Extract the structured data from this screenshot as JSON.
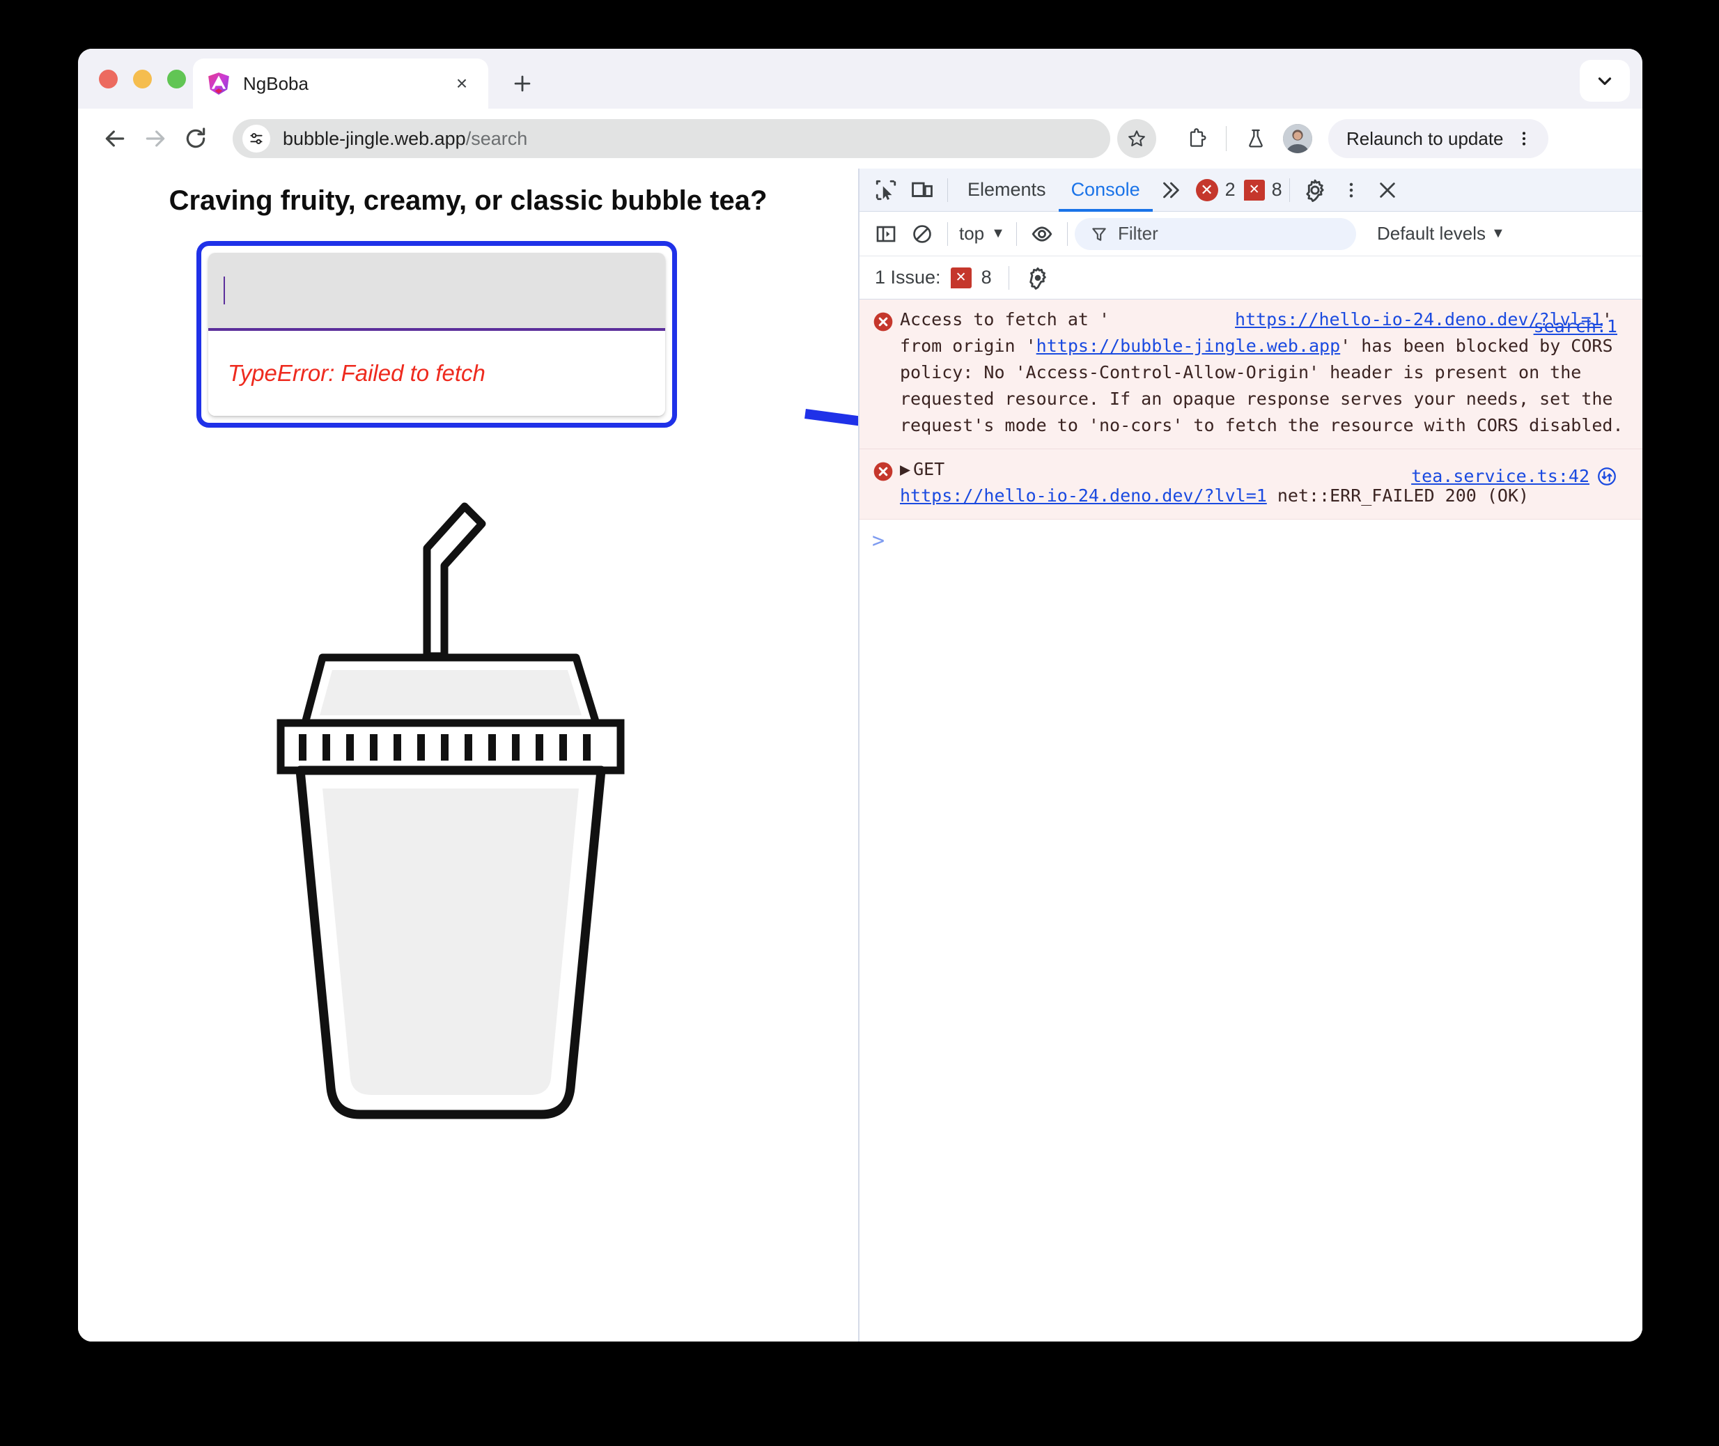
{
  "window": {
    "traffic_lights": [
      "close",
      "minimize",
      "maximize"
    ],
    "collapse_icon": "chevron-down-icon"
  },
  "tab": {
    "favicon": "angular-logo-icon",
    "title": "NgBoba",
    "close_label": "×",
    "new_tab_label": "+"
  },
  "toolbar": {
    "back_icon": "arrow-left-icon",
    "forward_icon": "arrow-right-icon",
    "reload_icon": "reload-icon",
    "site_info_icon": "tune-icon",
    "url_host": "bubble-jingle.web.app",
    "url_path": "/search",
    "bookmark_icon": "star-icon",
    "extensions_icon": "extension-icon",
    "labs_icon": "flask-icon",
    "avatar_icon": "profile-avatar",
    "relaunch_label": "Relaunch to update",
    "menu_icon": "kebab-menu-icon"
  },
  "page": {
    "heading": "Craving fruity, creamy, or classic bubble tea?",
    "search": {
      "value": "",
      "placeholder": "",
      "error": "TypeError: Failed to fetch"
    },
    "illustration": "bubble-tea-cup-icon",
    "annotation": {
      "highlight_color": "#1f31e8",
      "arrow": "blue-arrow-right"
    }
  },
  "devtools": {
    "inspect_icon": "inspect-element-icon",
    "device_icon": "device-toolbar-icon",
    "tabs": [
      {
        "label": "Elements",
        "active": false
      },
      {
        "label": "Console",
        "active": true
      }
    ],
    "more_tabs_icon": "chevron-double-right-icon",
    "error_badge": {
      "icon": "error-circle-icon",
      "count": "2"
    },
    "issue_badge": {
      "icon": "issue-square-icon",
      "count": "8"
    },
    "settings_icon": "gear-icon",
    "menu_icon": "kebab-menu-icon",
    "close_icon": "close-icon",
    "toolbar": {
      "sidebar_icon": "show-console-sidebar-icon",
      "clear_icon": "clear-console-icon",
      "context": "top",
      "context_caret": "▼",
      "eye_icon": "live-expression-icon",
      "filter_icon": "filter-funnel-icon",
      "filter_placeholder": "Filter",
      "levels_label": "Default levels",
      "levels_caret": "▼"
    },
    "issue_bar": {
      "label": "1 Issue:",
      "icon": "issue-square-icon",
      "count": "8",
      "settings_icon": "gear-icon"
    },
    "console_messages": [
      {
        "level": "error",
        "icon": "error-circle-icon",
        "source": "search:1",
        "segments": [
          {
            "text": "Access to fetch at '",
            "link": false
          },
          {
            "text": "https://hello-io-24.deno.dev/?lvl=1",
            "link": true
          },
          {
            "text": "' from origin '",
            "link": false
          },
          {
            "text": "https://bubble-jingle.web.app",
            "link": true
          },
          {
            "text": "' has been blocked by CORS policy: No 'Access-Control-Allow-Origin' header is present on the requested resource. If an opaque response serves your needs, set the request's mode to 'no-cors' to fetch the resource with CORS disabled.",
            "link": false
          }
        ]
      },
      {
        "level": "error",
        "icon": "error-circle-icon",
        "expander": "▶",
        "source": "tea.service.ts:42",
        "source_extra_icon": "network-request-icon",
        "segments": [
          {
            "text": "GET ",
            "link": false
          },
          {
            "text": "https://hello-io-24.deno.dev/?lvl=1",
            "link": true
          },
          {
            "text": " net::ERR_FAILED 200 (OK)",
            "link": false
          }
        ]
      }
    ],
    "prompt": ">"
  },
  "colors": {
    "accent_blue": "#1a73e8",
    "annotation_blue": "#1f31e8",
    "error_red": "#c5372c",
    "page_error_red": "#ee2a1e",
    "input_purple": "#5c2f9b",
    "log_bg": "#fcf0ef"
  }
}
